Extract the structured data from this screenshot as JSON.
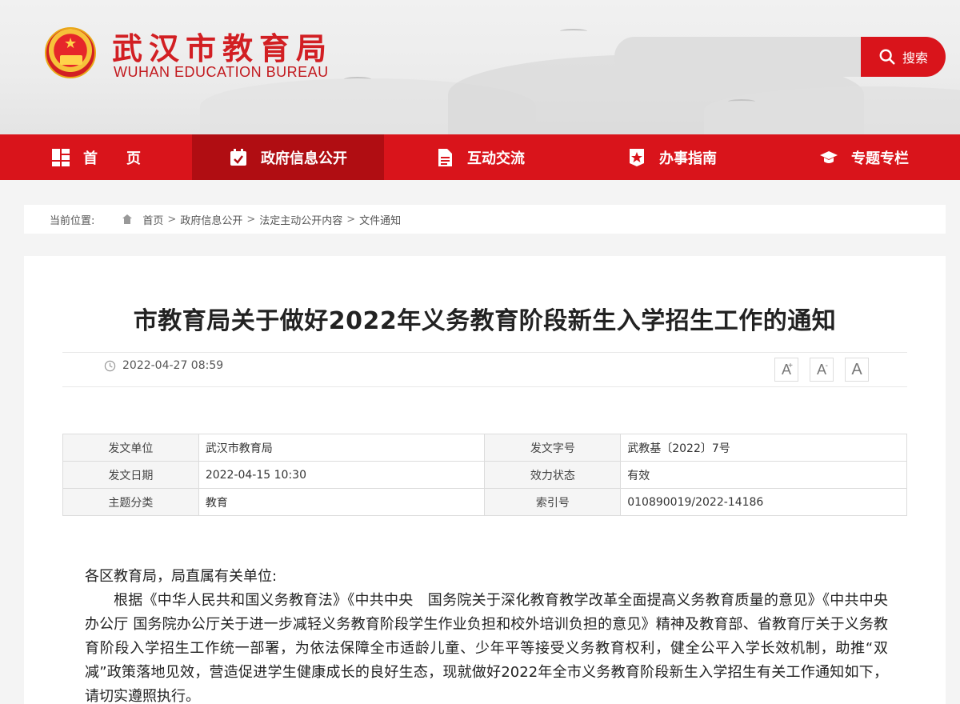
{
  "header": {
    "title": "武汉市教育局",
    "subtitle": "WUHAN EDUCATION BUREAU",
    "search": {
      "placeholder": "",
      "button_label": "搜索"
    }
  },
  "nav": {
    "items": [
      {
        "label": "首　　页",
        "icon": "home-grid-icon"
      },
      {
        "label": "政府信息公开",
        "icon": "calendar-check-icon",
        "active": true
      },
      {
        "label": "互动交流",
        "icon": "document-icon"
      },
      {
        "label": "办事指南",
        "icon": "star-badge-icon"
      },
      {
        "label": "专题专栏",
        "icon": "graduation-cap-icon"
      }
    ]
  },
  "breadcrumb": {
    "label": "当前位置:",
    "items": [
      "首页",
      "政府信息公开",
      "法定主动公开内容",
      "文件通知"
    ],
    "separator": ">"
  },
  "article": {
    "title": "市教育局关于做好2022年义务教育阶段新生入学招生工作的通知",
    "publish_time": "2022-04-27 08:59",
    "font_controls": [
      "A",
      "A",
      "A"
    ],
    "info": {
      "unit_label": "发文单位",
      "unit_value": "武汉市教育局",
      "doc_no_label": "发文字号",
      "doc_no_value": "武教基〔2022〕7号",
      "date_label": "发文日期",
      "date_value": "2022-04-15 10:30",
      "status_label": "效力状态",
      "status_value": "有效",
      "topic_label": "主题分类",
      "topic_value": "教育",
      "index_label": "索引号",
      "index_value": "010890019/2022-14186"
    },
    "salutation": "各区教育局，局直属有关单位:",
    "paragraph_1": "根据《中华人民共和国义务教育法》《中共中央　国务院关于深化教育教学改革全面提高义务教育质量的意见》《中共中央办公厅 国务院办公厅关于进一步减轻义务教育阶段学生作业负担和校外培训负担的意见》精神及教育部、省教育厅关于义务教育阶段入学招生工作统一部署，为依法保障全市适龄儿童、少年平等接受义务教育权利，健全公平入学长效机制，助推“双减”政策落地见效，营造促进学生健康成长的良好生态，现就做好2022年全市义务教育阶段新生入学招生有关工作通知如下，请切实遵照执行。"
  },
  "colors": {
    "brand_red": "#d9141b",
    "nav_active": "#b00d12"
  }
}
